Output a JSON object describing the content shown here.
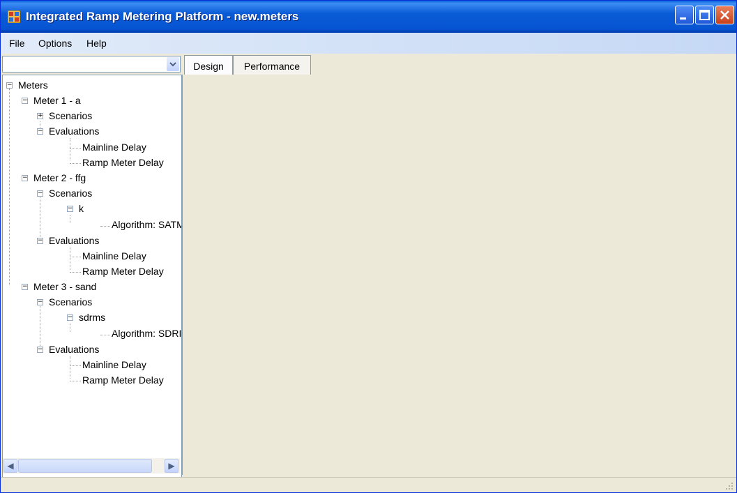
{
  "window": {
    "title": "Integrated Ramp Metering Platform - new.meters"
  },
  "menu": {
    "items": [
      "File",
      "Options",
      "Help"
    ]
  },
  "tabs": [
    {
      "label": "Design",
      "active": true
    },
    {
      "label": "Performance",
      "active": false
    }
  ],
  "tree": {
    "root": "Meters",
    "m1": {
      "label": "Meter 1 - a",
      "scenarios": "Scenarios",
      "evaluations": "Evaluations",
      "eval1": "Mainline Delay",
      "eval2": "Ramp Meter Delay"
    },
    "m2": {
      "label": "Meter 2 - ffg",
      "scenarios": "Scenarios",
      "scenario": "k",
      "algorithm": "Algorithm: SATM",
      "evaluations": "Evaluations",
      "eval1": "Mainline Delay",
      "eval2": "Ramp Meter Delay"
    },
    "m3": {
      "label": "Meter 3 - sand",
      "scenarios": "Scenarios",
      "scenario": "sdrms",
      "algorithm": "Algorithm: SDRI",
      "evaluations": "Evaluations",
      "eval1": "Mainline Delay",
      "eval2": "Ramp Meter Delay"
    }
  },
  "icons": {
    "app": "app-icon",
    "minimize": "minimize-icon",
    "maximize": "maximize-icon",
    "close": "close-icon",
    "combo": "chevron-down-icon",
    "scroll_left": "arrow-left-icon",
    "scroll_right": "arrow-right-icon"
  },
  "colors": {
    "title_bar": "#0654d2",
    "window_bg": "#ece9d8",
    "close_button": "#c9411b"
  }
}
